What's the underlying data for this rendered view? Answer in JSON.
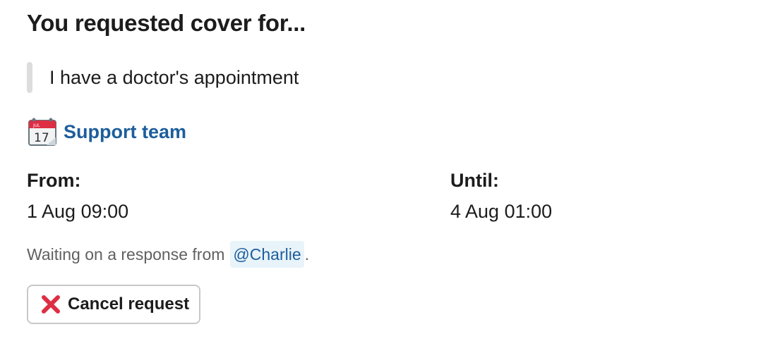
{
  "message": {
    "title": "You requested cover for...",
    "reason": "I have a doctor's appointment",
    "team": {
      "icon": "calendar-icon",
      "calendar_month": "JUL",
      "calendar_day": "17",
      "name": "Support team"
    },
    "from": {
      "label": "From:",
      "value": "1 Aug 09:00"
    },
    "until": {
      "label": "Until:",
      "value": "4 Aug 01:00"
    },
    "status": {
      "prefix": "Waiting on a response from",
      "mention": "@Charlie",
      "suffix": "."
    },
    "cancel_button": {
      "icon": "cross-mark-icon",
      "label": "Cancel request"
    }
  },
  "colors": {
    "link": "#1d5e9c",
    "mention_bg": "#e8f3fa",
    "quote_bar": "#dddddd",
    "cancel_icon": "#dd2e44"
  }
}
